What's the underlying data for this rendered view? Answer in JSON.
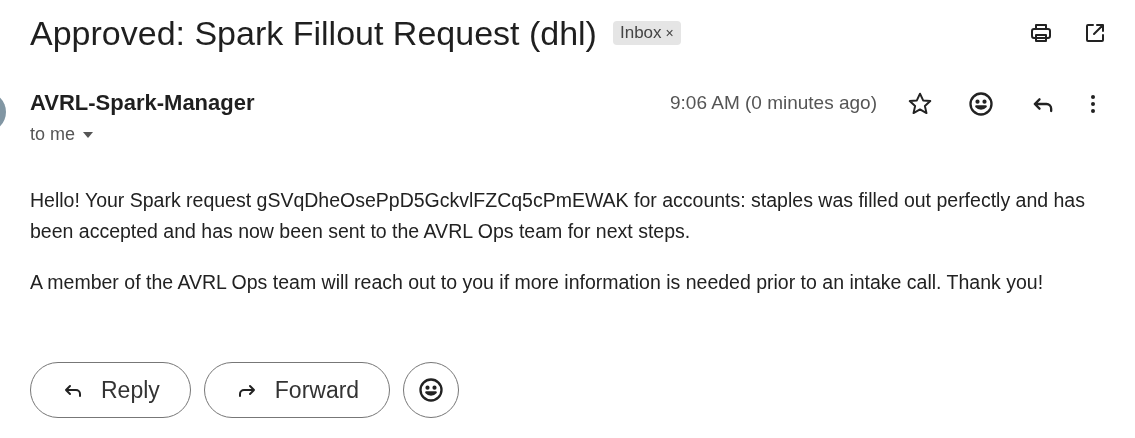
{
  "subject": "Approved: Spark Fillout Request (dhl)",
  "label": {
    "text": "Inbox",
    "remove": "×"
  },
  "sender": {
    "name": "AVRL-Spark-Manager",
    "recipient": "to me"
  },
  "time": "9:06 AM (0 minutes ago)",
  "starred": false,
  "body": [
    "Hello! Your Spark request gSVqDheOsePpD5GckvlFZCq5cPmEWAK for accounts: staples was filled out perfectly and has been accepted and has now been sent to the AVRL Ops team for next steps.",
    "A member of the AVRL Ops team will reach out to you if more information is needed prior to an intake call. Thank you!"
  ],
  "actions": [
    {
      "kind": "reply",
      "label": "Reply"
    },
    {
      "kind": "forward",
      "label": "Forward"
    },
    {
      "kind": "emoji"
    }
  ]
}
